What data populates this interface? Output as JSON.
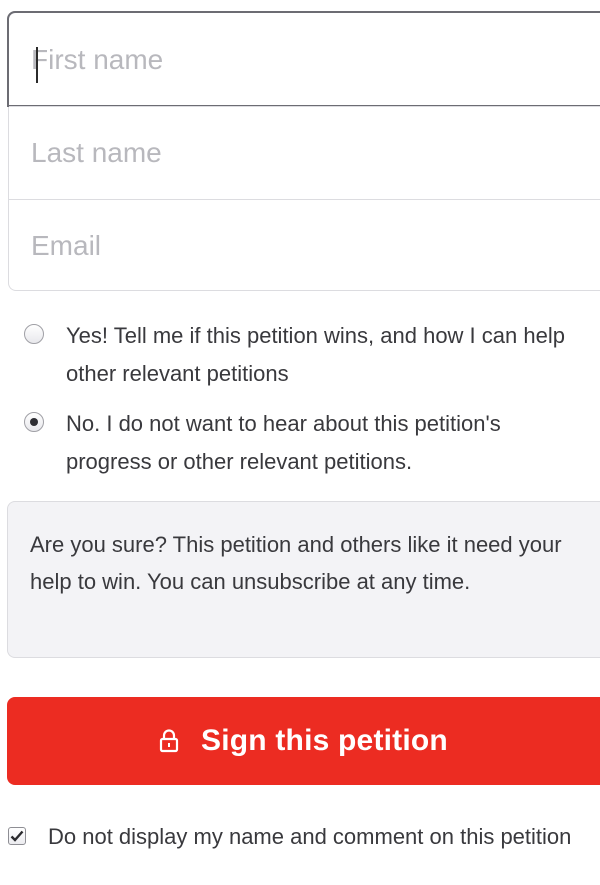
{
  "form": {
    "first_name_placeholder": "First name",
    "last_name_placeholder": "Last name",
    "email_placeholder": "Email"
  },
  "subscription": {
    "options": [
      {
        "label": "Yes! Tell me if this petition wins, and how I can help other relevant petitions",
        "selected": false
      },
      {
        "label": "No. I do not want to hear about this petition's progress or other relevant petitions.",
        "selected": true
      }
    ]
  },
  "notice": {
    "text": "Are you sure? This petition and others like it need your help to win. You can unsubscribe at any time."
  },
  "sign_button": {
    "label": "Sign this petition",
    "icon": "lock-icon",
    "color": "#ec2c22"
  },
  "privacy_checkbox": {
    "label": "Do not display my name and comment on this petition",
    "checked": true
  }
}
